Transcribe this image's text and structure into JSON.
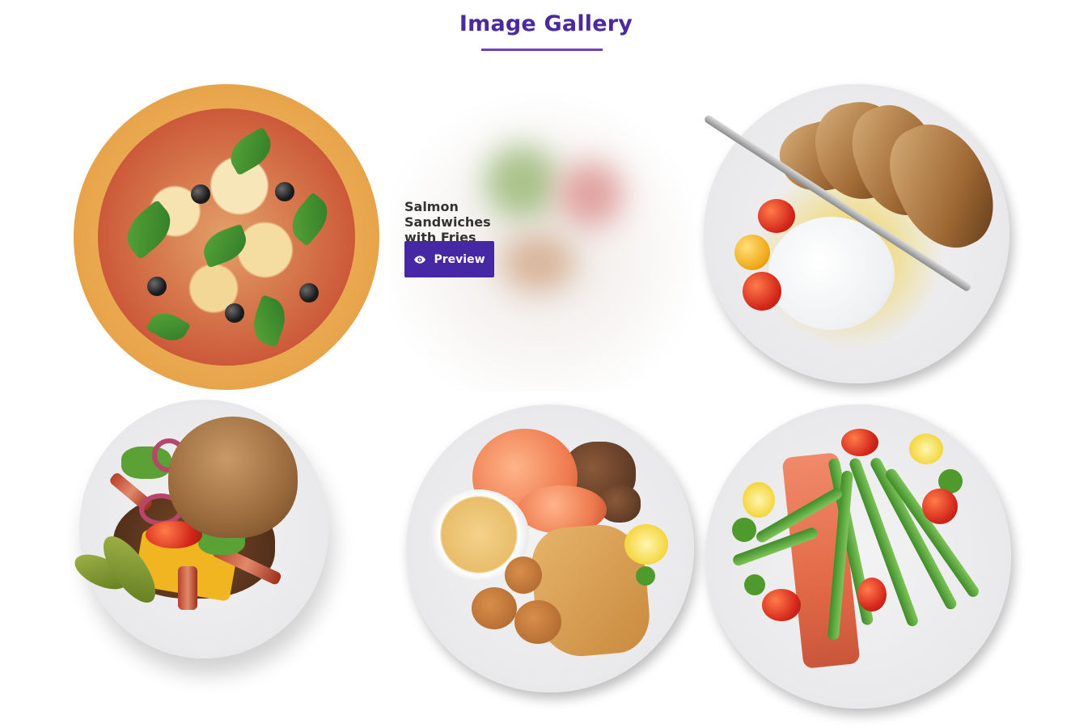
{
  "header": {
    "title": "Image Gallery"
  },
  "gallery": {
    "items": [
      {
        "name": "pizza"
      },
      {
        "name": "salmon-sandwiches",
        "caption": "Salmon Sandwiches with Fries",
        "button_label": "Preview"
      },
      {
        "name": "burrata-plate"
      },
      {
        "name": "burger"
      },
      {
        "name": "seafood-plate"
      },
      {
        "name": "salmon-asparagus"
      }
    ]
  },
  "colors": {
    "accent": "#4728a4",
    "title": "#4b2aa0",
    "underline": "#6f3fc0"
  },
  "icons": {
    "preview": "eye-icon"
  }
}
